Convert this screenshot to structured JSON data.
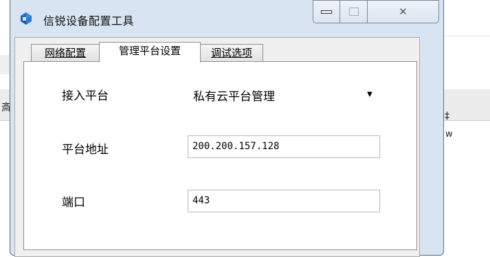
{
  "window": {
    "title": "信锐设备配置工具",
    "app_icon": "app-logo-icon",
    "controls": [
      "minimize-icon",
      "maximize-icon",
      "close-icon"
    ],
    "close_glyph": "✕"
  },
  "tabs": [
    {
      "label": "网络配置",
      "active": false
    },
    {
      "label": "管理平台设置",
      "active": true
    },
    {
      "label": "调试选项",
      "active": false
    }
  ],
  "form": {
    "platform_label": "接入平台",
    "platform_value": "私有云平台管理",
    "address_label": "平台地址",
    "address_value": "200.200.157.128",
    "port_label": "端口",
    "port_value": "443"
  },
  "background": {
    "left_char": "斎",
    "right_char": "‡",
    "right_char2": "w"
  },
  "colors": {
    "titlebar": "#d8e4f1",
    "accent": "#1e6fc8"
  }
}
